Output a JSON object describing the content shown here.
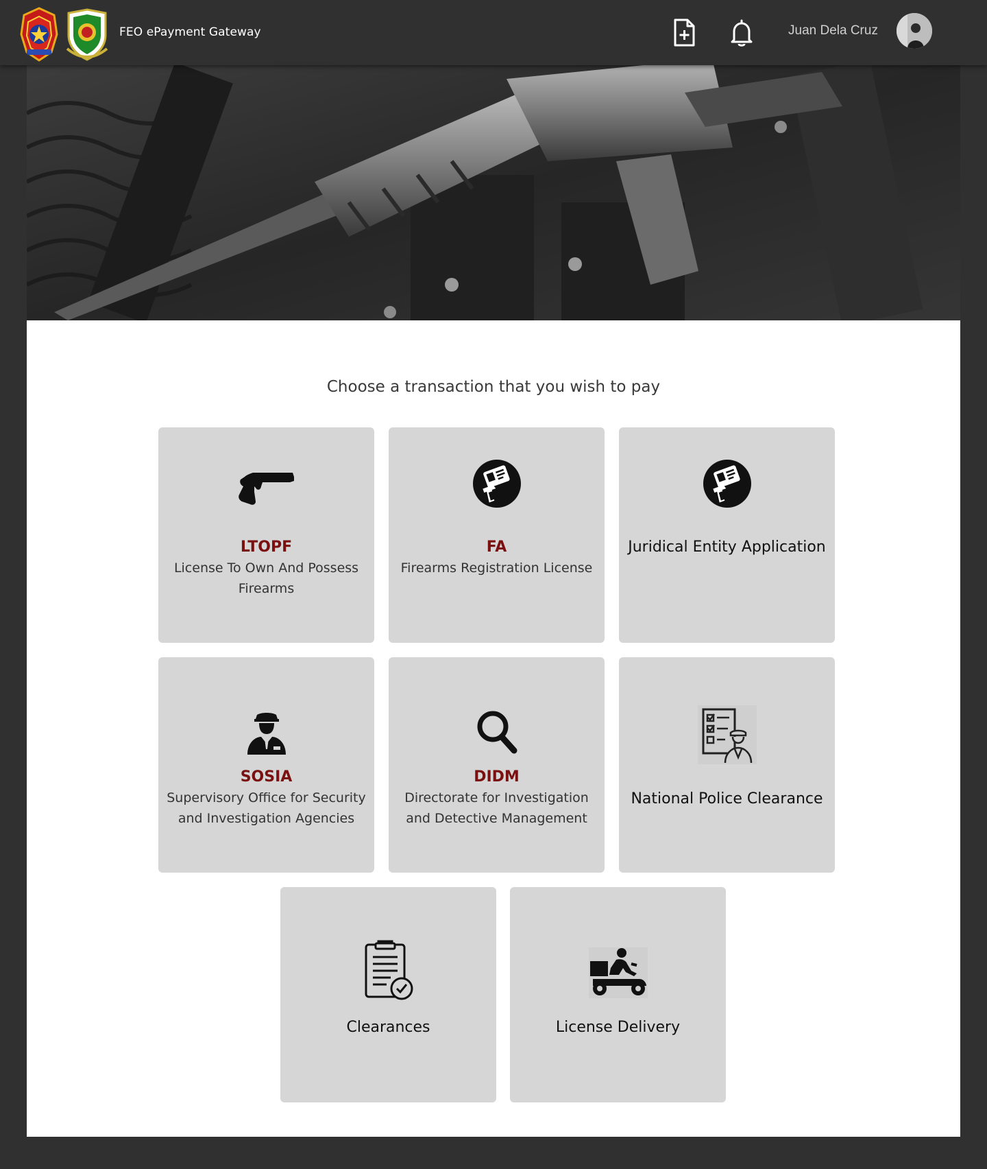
{
  "header": {
    "app_title": "FEO ePayment Gateway",
    "user_name": "Juan Dela Cruz",
    "icons": [
      "document-add-icon",
      "bell-icon"
    ]
  },
  "main": {
    "prompt": "Choose a transaction that you wish to pay",
    "tiles": [
      {
        "code": "LTOPF",
        "description": "License To Own And Possess Firearms",
        "icon": "handgun-icon"
      },
      {
        "code": "FA",
        "description": "Firearms Registration License",
        "icon": "firearm-license-icon"
      },
      {
        "title": "Juridical Entity Application",
        "icon": "firearm-license-icon"
      },
      {
        "code": "SOSIA",
        "description": "Supervisory Office for Security and Investigation Agencies",
        "icon": "security-guard-icon"
      },
      {
        "code": "DIDM",
        "description": "Directorate for Investigation and Detective Management",
        "icon": "magnifier-icon"
      },
      {
        "title": "National Police Clearance",
        "icon": "police-checklist-icon"
      },
      {
        "title": "Clearances",
        "icon": "clipboard-check-icon"
      },
      {
        "title": "License Delivery",
        "icon": "delivery-scooter-icon"
      }
    ]
  },
  "colors": {
    "topbar": "#303030",
    "tile": "#d6d6d6",
    "code_accent": "#7a1010"
  }
}
